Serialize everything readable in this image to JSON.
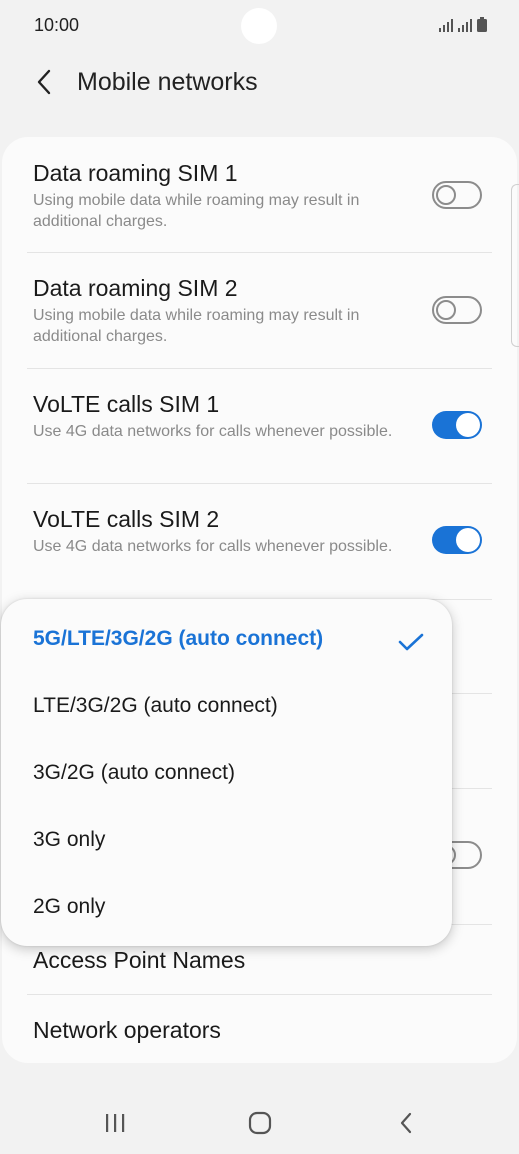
{
  "status_bar": {
    "time": "10:00"
  },
  "header": {
    "title": "Mobile networks"
  },
  "settings": [
    {
      "title": "Data roaming SIM 1",
      "subtitle": "Using mobile data while roaming may result in additional charges.",
      "toggle": "off"
    },
    {
      "title": "Data roaming SIM 2",
      "subtitle": "Using mobile data while roaming may result in additional charges.",
      "toggle": "off"
    },
    {
      "title": "VoLTE calls SIM 1",
      "subtitle": "Use 4G data networks for calls whenever possible.",
      "toggle": "on"
    },
    {
      "title": "VoLTE calls SIM 2",
      "subtitle": "Use 4G data networks for calls whenever possible.",
      "toggle": "on"
    },
    {
      "title": "Access Point Names"
    },
    {
      "title": "Network operators"
    }
  ],
  "network_mode_menu": {
    "options": [
      "5G/LTE/3G/2G (auto connect)",
      "LTE/3G/2G (auto connect)",
      "3G/2G (auto connect)",
      "3G only",
      "2G only"
    ],
    "selected": "5G/LTE/3G/2G (auto connect)"
  },
  "colors": {
    "accent": "#1a73d6",
    "background": "#f2f2f2",
    "card": "#fbfbfb",
    "secondary_text": "#8a8a8a"
  },
  "icons": {
    "back": "chevron-left-icon",
    "check": "check-icon",
    "nav_recents": "recents-icon",
    "nav_home": "home-icon",
    "nav_back": "back-icon"
  }
}
